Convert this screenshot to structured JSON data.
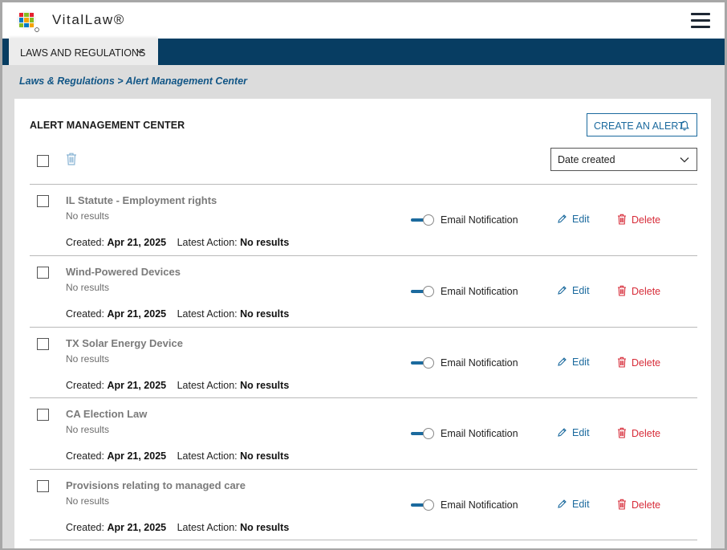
{
  "app": {
    "brand": "VitalLaw®",
    "logo_icon": "wolters-kluwer-logo",
    "menu_icon": "hamburger-menu-icon"
  },
  "nav": {
    "tab_label": "LAWS AND REGULATIONS"
  },
  "breadcrumb": {
    "root": "Laws & Regulations",
    "separator": ">",
    "current": "Alert Management Center"
  },
  "page": {
    "title": "ALERT MANAGEMENT CENTER",
    "create_label": "CREATE AN ALERT",
    "sort_value": "Date created"
  },
  "labels": {
    "created": "Created:",
    "latest_action": "Latest Action:",
    "email_notification": "Email Notification",
    "edit": "Edit",
    "delete": "Delete"
  },
  "alerts": [
    {
      "title": "IL Statute - Employment rights",
      "status": "No results",
      "created": "Apr 21, 2025",
      "latest_action": "No results",
      "email_notification": true
    },
    {
      "title": "Wind-Powered Devices",
      "status": "No results",
      "created": "Apr 21, 2025",
      "latest_action": "No results",
      "email_notification": true
    },
    {
      "title": "TX Solar Energy Device",
      "status": "No results",
      "created": "Apr 21, 2025",
      "latest_action": "No results",
      "email_notification": true
    },
    {
      "title": "CA Election Law",
      "status": "No results",
      "created": "Apr 21, 2025",
      "latest_action": "No results",
      "email_notification": true
    },
    {
      "title": "Provisions relating to managed care",
      "status": "No results",
      "created": "Apr 21, 2025",
      "latest_action": "No results",
      "email_notification": true
    }
  ],
  "colors": {
    "nav_bg": "#073d62",
    "link": "#1b6a9e",
    "delete": "#d72c39",
    "breadcrumb": "#125686"
  }
}
